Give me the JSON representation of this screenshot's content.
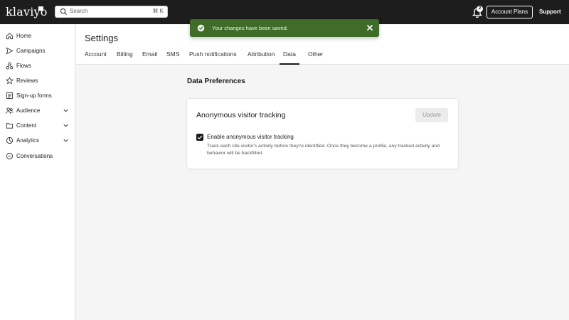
{
  "app": {
    "logo": "klaviyo",
    "search": {
      "placeholder": "Search",
      "shortcut": "⌘ K"
    },
    "notifications_count": "2",
    "account_plans": "Account Plans",
    "support": "Support"
  },
  "sidebar": {
    "items": [
      {
        "label": "Home",
        "icon": "home-icon"
      },
      {
        "label": "Campaigns",
        "icon": "send-icon"
      },
      {
        "label": "Flows",
        "icon": "flows-icon"
      },
      {
        "label": "Reviews",
        "icon": "star-icon"
      },
      {
        "label": "Sign-up forms",
        "icon": "form-icon"
      },
      {
        "label": "Audience",
        "icon": "people-icon",
        "expandable": true
      },
      {
        "label": "Content",
        "icon": "folder-icon",
        "expandable": true
      },
      {
        "label": "Analytics",
        "icon": "chart-icon",
        "expandable": true
      },
      {
        "label": "Conversations",
        "icon": "chat-icon"
      }
    ]
  },
  "page": {
    "title": "Settings",
    "tabs": [
      {
        "label": "Account"
      },
      {
        "label": "Billing"
      },
      {
        "label": "Email"
      },
      {
        "label": "SMS"
      },
      {
        "label": "Push notifications"
      },
      {
        "label": "Attribution"
      },
      {
        "label": "Data",
        "active": true
      },
      {
        "label": "Other"
      }
    ],
    "section_title": "Data Preferences",
    "card": {
      "title": "Anonymous visitor tracking",
      "update_label": "Update",
      "checkbox_label": "Enable anonymous visitor tracking",
      "checkbox_checked": true,
      "description": "Track each site visitor's activity before they're identified. Once they become a profile, any tracked activity and behavior will be backfilled."
    }
  },
  "toast": {
    "message": "Your changes have been saved.",
    "color": "#3f6c28"
  }
}
